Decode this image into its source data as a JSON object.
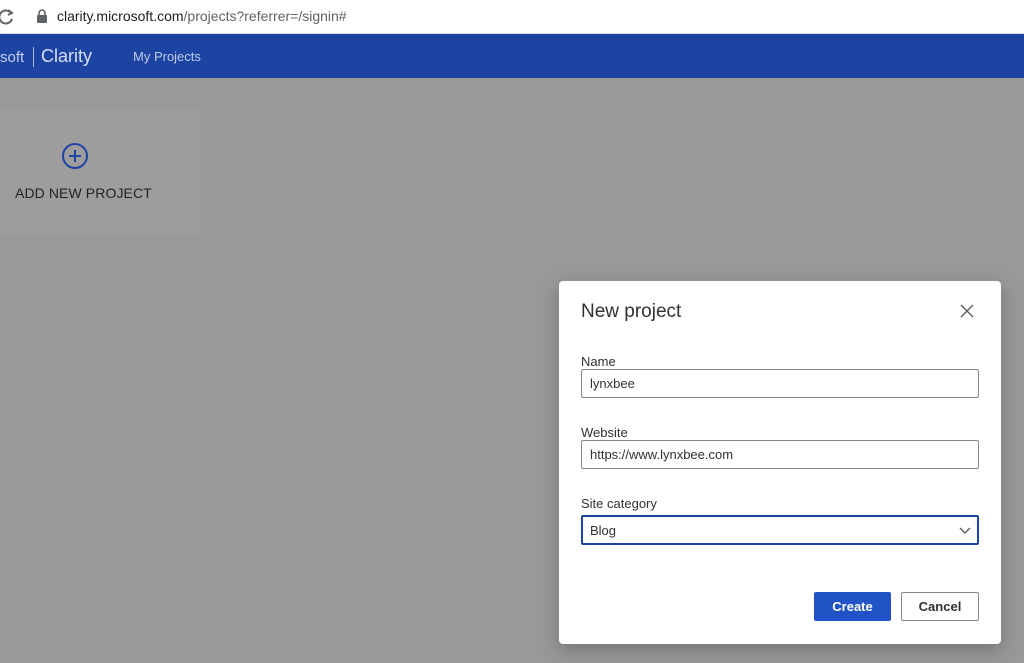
{
  "browser": {
    "url_host": "clarity.microsoft.com",
    "url_path": "/projects?referrer=/signin#"
  },
  "header": {
    "brand_microsoft": "soft",
    "brand_product": "Clarity",
    "nav_my_projects": "My Projects",
    "color": "#1d43a3"
  },
  "projects": {
    "add_new_label": "ADD NEW PROJECT"
  },
  "dialog": {
    "title": "New project",
    "name_label": "Name",
    "name_value": "lynxbee",
    "website_label": "Website",
    "website_value": "https://www.lynxbee.com",
    "category_label": "Site category",
    "category_value": "Blog",
    "create_label": "Create",
    "cancel_label": "Cancel",
    "primary_color": "#2253c6"
  }
}
